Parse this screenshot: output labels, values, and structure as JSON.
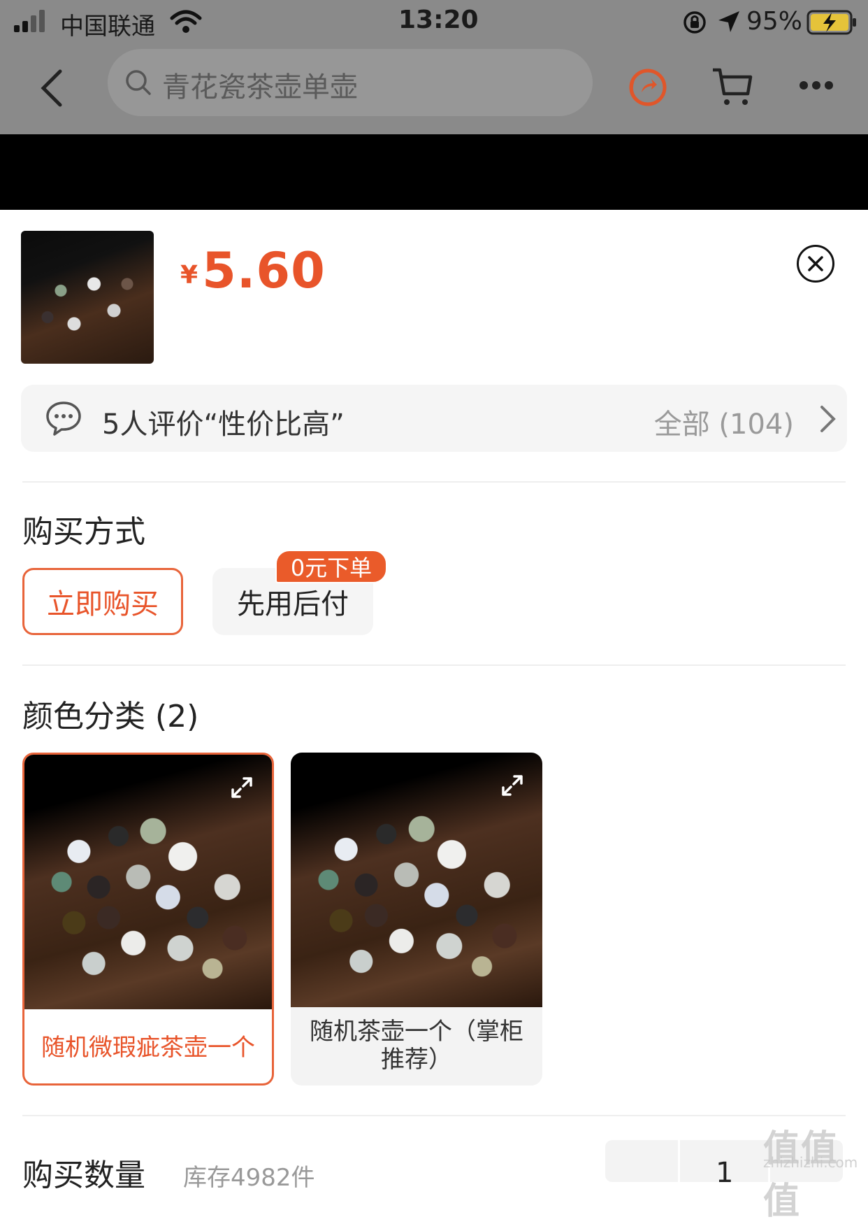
{
  "status_bar": {
    "carrier": "中国联通",
    "time": "13:20",
    "battery": "95%"
  },
  "nav": {
    "search_placeholder": "青花瓷茶壶单壶"
  },
  "product": {
    "currency": "¥",
    "price": "5.60"
  },
  "reviews": {
    "summary": "5人评价“性价比高”",
    "all_label": "全部 (104)"
  },
  "purchase": {
    "title": "购买方式",
    "options": [
      {
        "label": "立即购买",
        "selected": true
      },
      {
        "label": "先用后付",
        "selected": false,
        "badge": "0元下单"
      }
    ]
  },
  "color": {
    "title": "颜色分类 (2)",
    "variants": [
      {
        "label": "随机微瑕疵茶壶一个",
        "selected": true
      },
      {
        "label": "随机茶壶一个（掌柜推荐）",
        "selected": false
      }
    ]
  },
  "quantity": {
    "title": "购买数量",
    "stock": "库存4982件",
    "value": "1"
  },
  "watermark": {
    "text": "值值值",
    "sub": "zhizhizhi.com"
  },
  "colors": {
    "accent": "#e8542a",
    "statusbar": "#8a8a8a",
    "sheet_bg": "#ffffff"
  }
}
